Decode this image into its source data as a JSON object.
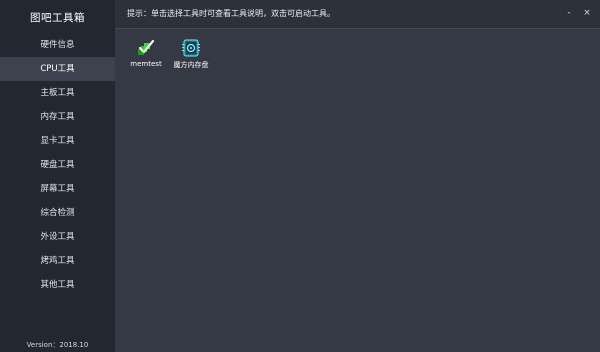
{
  "app_title": "图吧工具箱",
  "version": "Version：2018.10",
  "hint": "提示：单击选择工具时可查看工具说明，双击可启动工具。",
  "window_controls": {
    "minimize": "-",
    "close": "×"
  },
  "sidebar": {
    "items": [
      {
        "label": "硬件信息",
        "active": false
      },
      {
        "label": "CPU工具",
        "active": true
      },
      {
        "label": "主板工具",
        "active": false
      },
      {
        "label": "内存工具",
        "active": false
      },
      {
        "label": "显卡工具",
        "active": false
      },
      {
        "label": "硬盘工具",
        "active": false
      },
      {
        "label": "屏幕工具",
        "active": false
      },
      {
        "label": "综合检测",
        "active": false
      },
      {
        "label": "外设工具",
        "active": false
      },
      {
        "label": "烤鸡工具",
        "active": false
      },
      {
        "label": "其他工具",
        "active": false
      }
    ]
  },
  "tools": [
    {
      "label": "memtest",
      "icon": "memtest-icon"
    },
    {
      "label": "魔方内存盘",
      "icon": "ramdisk-icon"
    }
  ],
  "colors": {
    "sidebar_bg": "#232830",
    "content_bg": "#343944",
    "active_item": "#3c424e",
    "memtest_green": "#3cb43c",
    "ramdisk_teal": "#2aa6b8"
  }
}
